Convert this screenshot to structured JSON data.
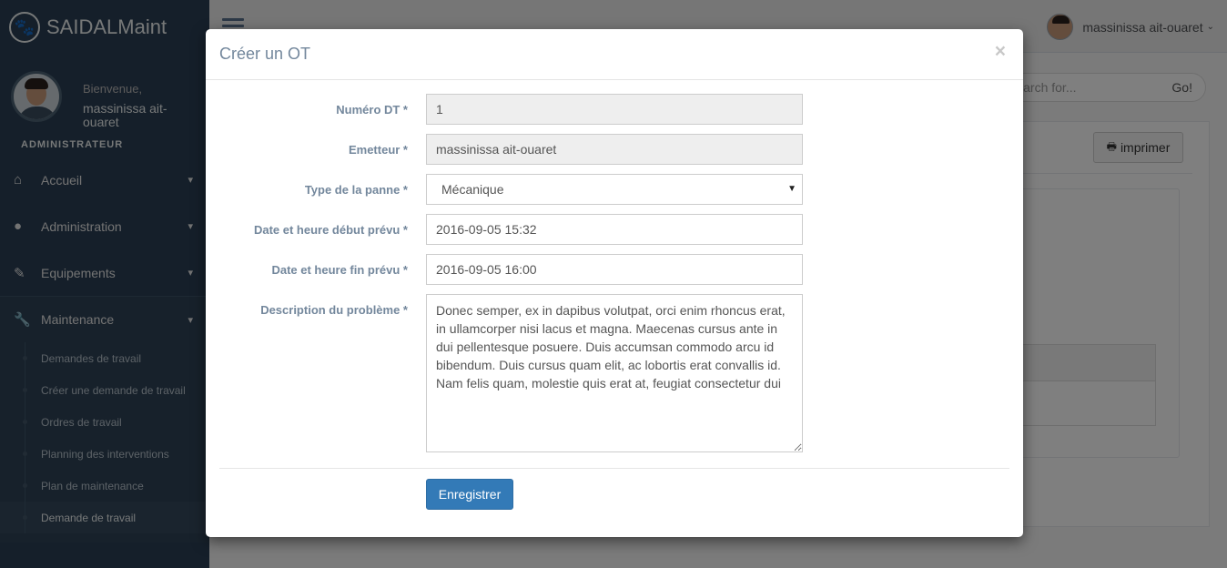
{
  "app": {
    "brand": "SAIDALMaint",
    "welcome": "Bienvenue,",
    "user_name": "massinissa ait-ouaret",
    "role": "ADMINISTRATEUR"
  },
  "sidebar": {
    "items": [
      {
        "label": "Accueil",
        "icon": "home-icon"
      },
      {
        "label": "Administration",
        "icon": "user-icon"
      },
      {
        "label": "Equipements",
        "icon": "edit-icon"
      },
      {
        "label": "Maintenance",
        "icon": "wrench-icon"
      }
    ],
    "submenu": [
      {
        "label": "Demandes de travail"
      },
      {
        "label": "Créer une demande de travail"
      },
      {
        "label": "Ordres de travail"
      },
      {
        "label": "Planning des interventions"
      },
      {
        "label": "Plan de maintenance"
      },
      {
        "label": "Demande de travail"
      }
    ]
  },
  "topnav": {
    "user_label": "massinissa ait-ouaret",
    "search_placeholder": "Search for...",
    "search_button": "Go!"
  },
  "content": {
    "print_label": "imprimer"
  },
  "modal": {
    "title": "Créer un OT",
    "close": "×",
    "fields": {
      "numero_dt": {
        "label": "Numéro DT *",
        "value": "1"
      },
      "emetteur": {
        "label": "Emetteur *",
        "value": "massinissa ait-ouaret"
      },
      "type_panne": {
        "label": "Type de la panne *",
        "value": "Mécanique"
      },
      "date_debut": {
        "label": "Date et heure début prévu *",
        "value": "2016-09-05 15:32"
      },
      "date_fin": {
        "label": "Date et heure fin prévu *",
        "value": "2016-09-05 16:00"
      },
      "description": {
        "label": "Description du problème *",
        "value": "Donec semper, ex in dapibus volutpat, orci enim rhoncus erat, in ullamcorper nisi lacus et magna. Maecenas cursus ante in dui pellentesque posuere. Duis accumsan commodo arcu id bibendum. Duis cursus quam elit, ac lobortis erat convallis id. Nam felis quam, molestie quis erat at, feugiat consectetur dui"
      }
    },
    "save_label": "Enregistrer"
  }
}
